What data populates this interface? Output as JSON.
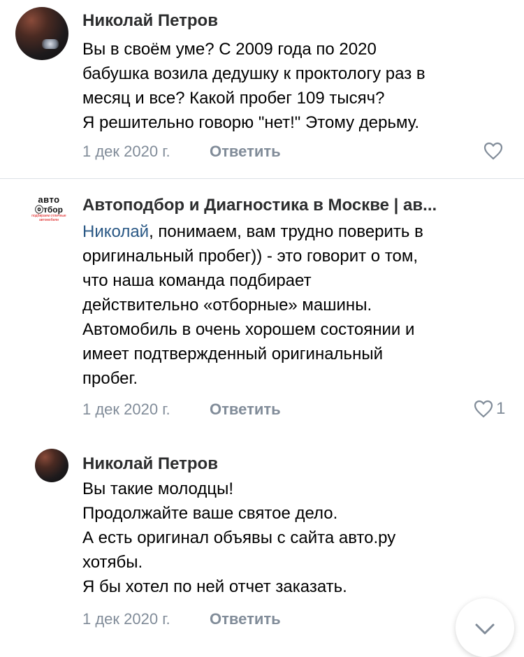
{
  "comments": [
    {
      "author": "Николай Петров",
      "avatar_icon": "user-photo-icon",
      "text": "Вы в своём уме? С 2009 года по 2020\nбабушка возила дедушку к проктологу раз в\nмесяц и все? Какой пробег 109 тысяч?\nЯ решительно говорю \"нет!\" Этому дерьму.",
      "date": "1 дек 2020 г.",
      "reply_label": "Ответить",
      "likes": ""
    },
    {
      "author": "Автоподбор и Диагностика в Москве | ав...",
      "avatar_icon": "autotbor-logo-icon",
      "logo_text": {
        "top": "авто",
        "mid": "ⓞтбор",
        "sub": "подбираем отличные автомобили"
      },
      "mention": "Николай",
      "text": ", понимаем, вам трудно поверить в\nоригинальный пробег)) - это говорит о том,\nчто наша команда подбирает\nдействительно «отборные» машины.\nАвтомобиль в очень хорошем состоянии и\nимеет подтвержденный оригинальный\nпробег.",
      "date": "1 дек 2020 г.",
      "reply_label": "Ответить",
      "likes": "1"
    },
    {
      "author": "Николай Петров",
      "avatar_icon": "user-photo-icon",
      "text": "Вы такие молодцы!\nПродолжайте ваше святое дело.\nА есть оригинал объявы с сайта авто.ру\nхотябы.\nЯ бы хотел по ней отчет заказать.",
      "date": "1 дек 2020 г.",
      "reply_label": "Ответить",
      "likes": ""
    }
  ],
  "icons": {
    "like": "heart-icon",
    "scroll": "chevron-down-icon"
  },
  "colors": {
    "link": "#2a5885",
    "meta": "#818c99",
    "divider": "#dce1e6"
  }
}
